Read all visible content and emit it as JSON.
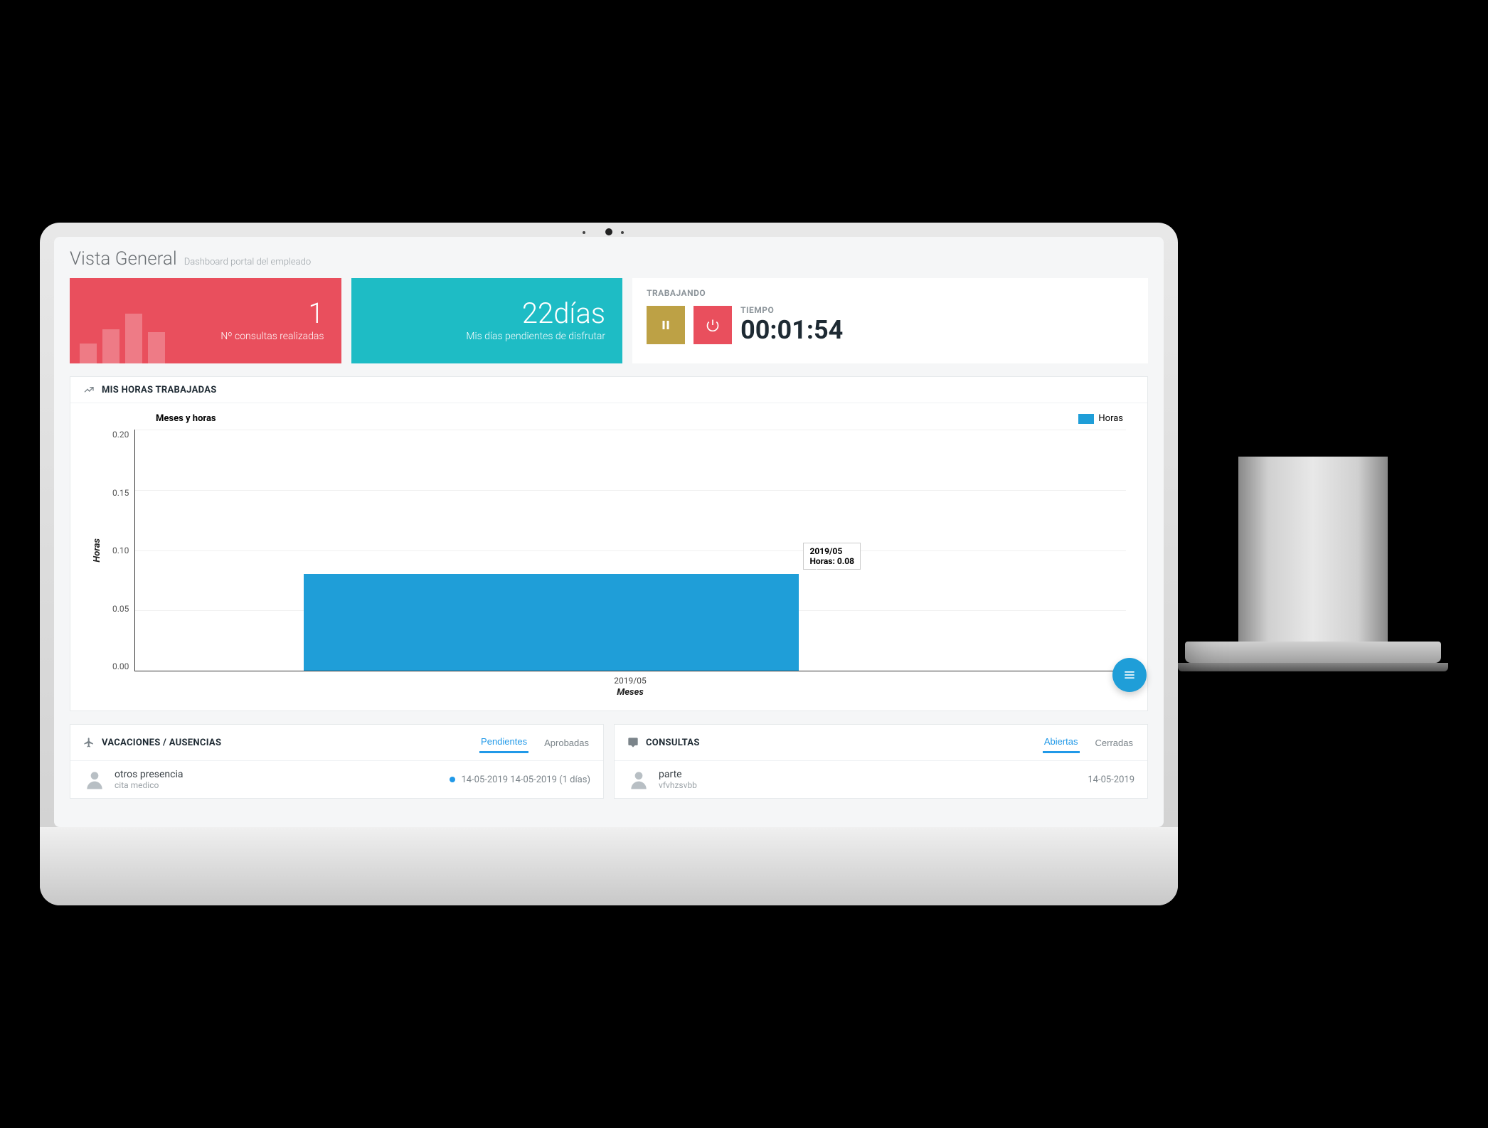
{
  "header": {
    "title": "Vista General",
    "subtitle": "Dashboard portal del empleado"
  },
  "cards": {
    "consultas": {
      "value": "1",
      "label": "Nº consultas realizadas"
    },
    "dias": {
      "value": "22días",
      "label": "Mis días pendientes de disfrutar"
    }
  },
  "timer": {
    "status": "TRABAJANDO",
    "time_label": "TIEMPO",
    "value": "00:01:54"
  },
  "chart_panel": {
    "title": "MIS HORAS TRABAJADAS"
  },
  "chart_data": {
    "type": "bar",
    "title": "Meses y horas",
    "xlabel": "Meses",
    "ylabel": "Horas",
    "ylim": [
      0,
      0.2
    ],
    "y_ticks": [
      "0.20",
      "0.15",
      "0.10",
      "0.05",
      "0.00"
    ],
    "categories": [
      "2019/05"
    ],
    "series": [
      {
        "name": "Horas",
        "values": [
          0.08
        ]
      }
    ],
    "legend": {
      "label": "Horas"
    },
    "tooltip": {
      "category": "2019/05",
      "series": "Horas",
      "value": "0.08"
    }
  },
  "vacaciones": {
    "title": "VACACIONES / AUSENCIAS",
    "tabs": {
      "pendientes": "Pendientes",
      "aprobadas": "Aprobadas"
    },
    "items": [
      {
        "primary": "otros presencia",
        "secondary": "cita medico",
        "meta": "14-05-2019 14-05-2019 (1 días)"
      }
    ]
  },
  "consultas_panel": {
    "title": "CONSULTAS",
    "tabs": {
      "abiertas": "Abiertas",
      "cerradas": "Cerradas"
    },
    "items": [
      {
        "primary": "parte",
        "secondary": "vfvhzsvbb",
        "meta": "14-05-2019"
      }
    ]
  }
}
